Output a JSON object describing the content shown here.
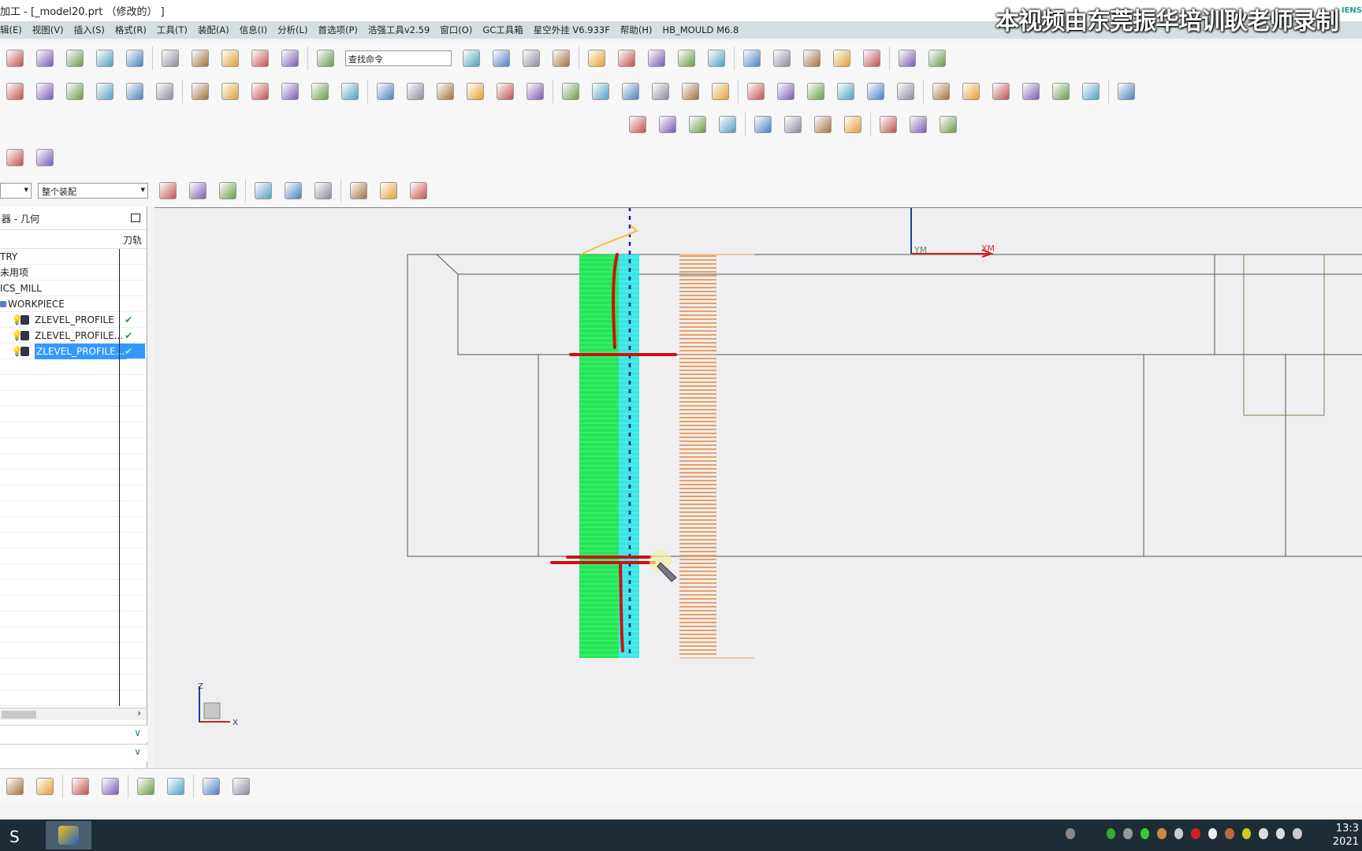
{
  "window": {
    "title": "加工 - [_model20.prt （修改的） ]",
    "brand": "IENS"
  },
  "watermark": "本视频由东莞振华培训耿老师录制",
  "menu": [
    "辑(E)",
    "视图(V)",
    "插入(S)",
    "格式(R)",
    "工具(T)",
    "装配(A)",
    "信息(I)",
    "分析(L)",
    "首选项(P)",
    "浩强工具v2.59",
    "窗口(O)",
    "GC工具箱",
    "星空外挂 V6.933F",
    "帮助(H)",
    "HB_MOULD M6.8"
  ],
  "toolbar": {
    "search_placeholder": "查找命令",
    "filter_value": "",
    "scope_value": "整个装配"
  },
  "navigator": {
    "title": "导航器 - 几何",
    "title_visible": "器 - 几何",
    "col_toolpath": "刀轨",
    "items": [
      {
        "label": "TRY",
        "indent": 0,
        "check": false
      },
      {
        "label": "未用项",
        "label_visible": "用项",
        "indent": 0,
        "check": false
      },
      {
        "label": "ICS_MILL",
        "indent": 0,
        "check": false
      },
      {
        "label": "WORKPIECE",
        "indent": 1,
        "check": false
      },
      {
        "label": "ZLEVEL_PROFILE",
        "indent": 2,
        "check": true
      },
      {
        "label": "ZLEVEL_PROFILE...",
        "indent": 2,
        "check": true
      },
      {
        "label": "ZLEVEL_PROFILE...",
        "indent": 2,
        "check": true,
        "selected": true
      }
    ]
  },
  "viewport": {
    "axis_x": "XM",
    "axis_y": "YM",
    "wcs_x": "X",
    "wcs_z": "Z",
    "toolpath_colors": {
      "cut": "#22e855",
      "cut2": "#39e6e6",
      "stock": "#e8a060",
      "annot": "#cc1111"
    }
  },
  "taskbar": {
    "time": "13:3",
    "date": "2021"
  },
  "icons": {
    "row1": [
      "new",
      "open",
      "save",
      "print",
      "cut",
      "copy",
      "paste",
      "delete",
      "undo",
      "view-cube",
      "info",
      "search",
      "fit",
      "shade",
      "wireframe",
      "folder",
      "page",
      "color",
      "move",
      "mirror",
      "layer",
      "tree",
      "paint",
      "palette",
      "snap",
      "grid",
      "measure"
    ],
    "row2": [
      "create-tool",
      "create-op",
      "geometry",
      "method",
      "program",
      "delete-op",
      "info-op",
      "post",
      "edit",
      "path",
      "verify",
      "gen",
      "list",
      "report",
      "simulate",
      "time",
      "probe",
      "sequence",
      "hatch",
      "hatch2",
      "circle",
      "curve",
      "frame",
      "group",
      "tool-db",
      "gauge",
      "feed",
      "cutter",
      "drill",
      "turn",
      "mill-tree",
      "machine",
      "fixture",
      "point",
      "sphere",
      "cylinder",
      "export"
    ],
    "row3": [
      "check",
      "inspect",
      "table",
      "grid2",
      "flag",
      "doc",
      "sheet",
      "list2",
      "tool2",
      "clock",
      "library"
    ],
    "row4": [
      "table3",
      "perspective"
    ],
    "row5": [
      "assembly-filter",
      "unite",
      "select-filter",
      "reset",
      "binoculars",
      "hexagon",
      "rect-select",
      "shaded-box",
      "box"
    ],
    "bottom": [
      "workpiece",
      "tree2",
      "rainbow",
      "plus",
      "layer2",
      "cylinder2",
      "box3",
      "box4"
    ]
  }
}
